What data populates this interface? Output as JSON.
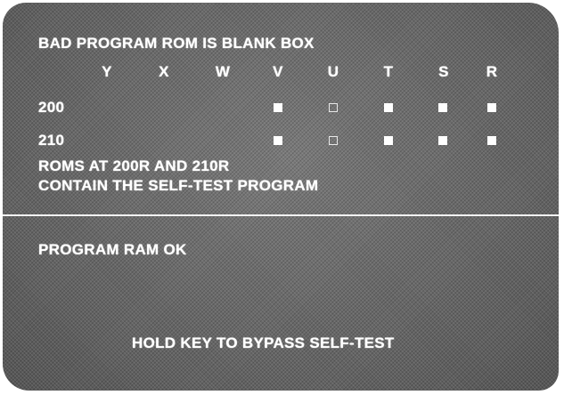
{
  "screen": {
    "header": "BAD PROGRAM ROM IS BLANK BOX",
    "columns": [
      "Y",
      "X",
      "W",
      "V",
      "U",
      "T",
      "S",
      "R"
    ],
    "rows": [
      {
        "label": "200",
        "cells": {
          "V": "filled",
          "U": "empty",
          "T": "filled",
          "S": "filled",
          "R": "filled"
        }
      },
      {
        "label": "210",
        "cells": {
          "V": "filled",
          "U": "empty",
          "T": "filled",
          "S": "filled",
          "R": "filled"
        }
      }
    ],
    "note_line1": "ROMS AT 200R AND 210R",
    "note_line2": "CONTAIN THE SELF-TEST PROGRAM",
    "ram_status": "PROGRAM RAM OK",
    "footer": "HOLD KEY TO BYPASS SELF-TEST"
  }
}
